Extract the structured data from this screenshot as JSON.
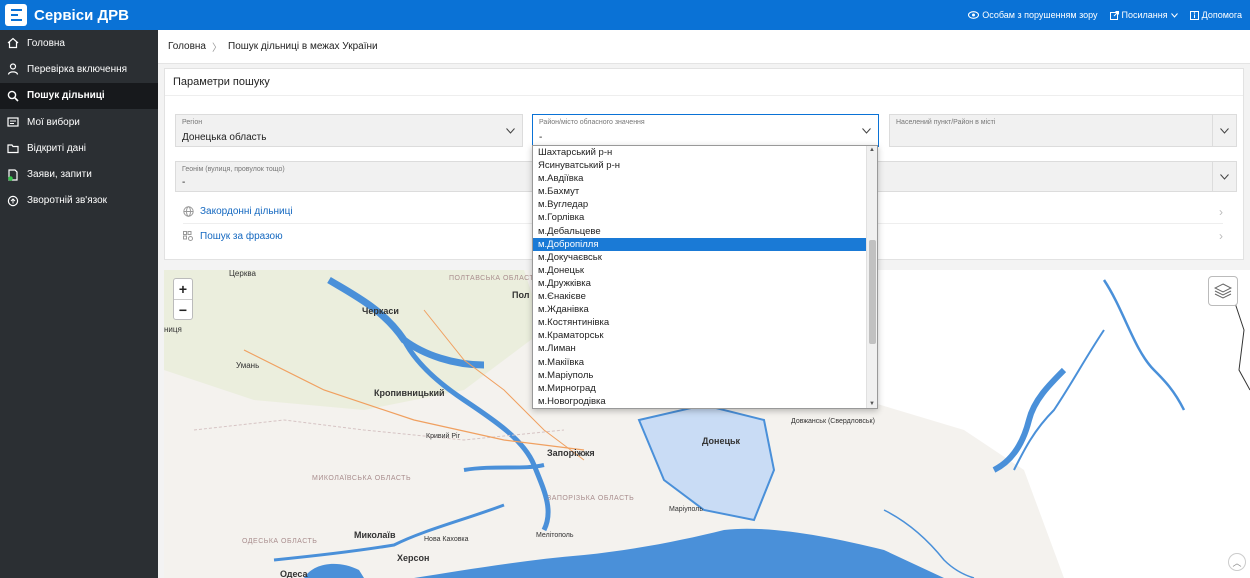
{
  "app": {
    "title": "Сервіси ДРВ"
  },
  "header": {
    "accessibility_label": "Особам з порушенням зору",
    "links_label": "Посилання",
    "help_label": "Допомога"
  },
  "sidebar": {
    "items": [
      {
        "label": "Головна",
        "icon": "home-icon",
        "active": false
      },
      {
        "label": "Перевірка включення",
        "icon": "user-icon",
        "active": false
      },
      {
        "label": "Пошук дільниці",
        "icon": "search-icon",
        "active": true
      },
      {
        "label": "Мої вибори",
        "icon": "ballot-icon",
        "active": false
      },
      {
        "label": "Відкриті дані",
        "icon": "folder-icon",
        "active": false
      },
      {
        "label": "Заяви, запити",
        "icon": "document-icon",
        "active": false
      },
      {
        "label": "Зворотній зв'язок",
        "icon": "feedback-icon",
        "active": false
      }
    ]
  },
  "breadcrumb": {
    "home": "Головна",
    "current": "Пошук дільниці в межах України"
  },
  "search": {
    "title": "Параметри пошуку",
    "region": {
      "label": "Регіон",
      "value": "Донецька область"
    },
    "district": {
      "label": "Район/місто обласного значення",
      "value": "-"
    },
    "settlement": {
      "label": "Населений пункт/Район в місті",
      "value": ""
    },
    "street": {
      "label": "Геонім (вулиця, провулок тощо)",
      "value": "-"
    },
    "foreign_label": "Закордонні дільниці",
    "phrase_label": "Пошук за фразою"
  },
  "dropdown": {
    "options": [
      "Шахтарський р-н",
      "Ясинуватський р-н",
      "м.Авдіївка",
      "м.Бахмут",
      "м.Вугледар",
      "м.Горлівка",
      "м.Дебальцеве",
      "м.Добропілля",
      "м.Докучаєвськ",
      "м.Донецьк",
      "м.Дружківка",
      "м.Єнакієве",
      "м.Жданівка",
      "м.Костянтинівка",
      "м.Краматорськ",
      "м.Лиман",
      "м.Макіївка",
      "м.Маріуполь",
      "м.Мирноград",
      "м.Новогродівка"
    ],
    "selected": "м.Добропілля"
  },
  "map": {
    "zoom_in": "+",
    "zoom_out": "−",
    "labels": {
      "cherkasy": "Черкаси",
      "kropyvnytskyi": "Кропивницький",
      "zaporizhzhia": "Запоріжжя",
      "mykolaiv": "Миколаїв",
      "kherson": "Херсон",
      "odesa": "Одеса",
      "donetsk": "Донецьк",
      "mariupol": "Маріуполь",
      "uman": "Умань",
      "kryvyi_rih": "Кривий Ріг",
      "tserkva": "Церква",
      "poltava_obl": "ПОЛТАВСЬКА ОБЛАСТЬ",
      "mykolaiv_obl": "МИКОЛАЇВСЬКА ОБЛАСТЬ",
      "zaporizhzhia_obl": "ЗАПОРІЗЬКА ОБЛАСТЬ",
      "odesa_obl": "ОДЕСЬКА ОБЛАСТЬ",
      "melitopol": "Мелітополь",
      "nova_kakhovka": "Нова Каховка",
      "dovzhansk": "Довжанськ (Свердловськ)",
      "nytsia": "ниця",
      "pol": "Пол"
    }
  },
  "colors": {
    "primary": "#0a72d6",
    "sidebar": "#2b2f33",
    "water": "#4a90d9",
    "donetsk_fill": "#c9dcf5"
  }
}
